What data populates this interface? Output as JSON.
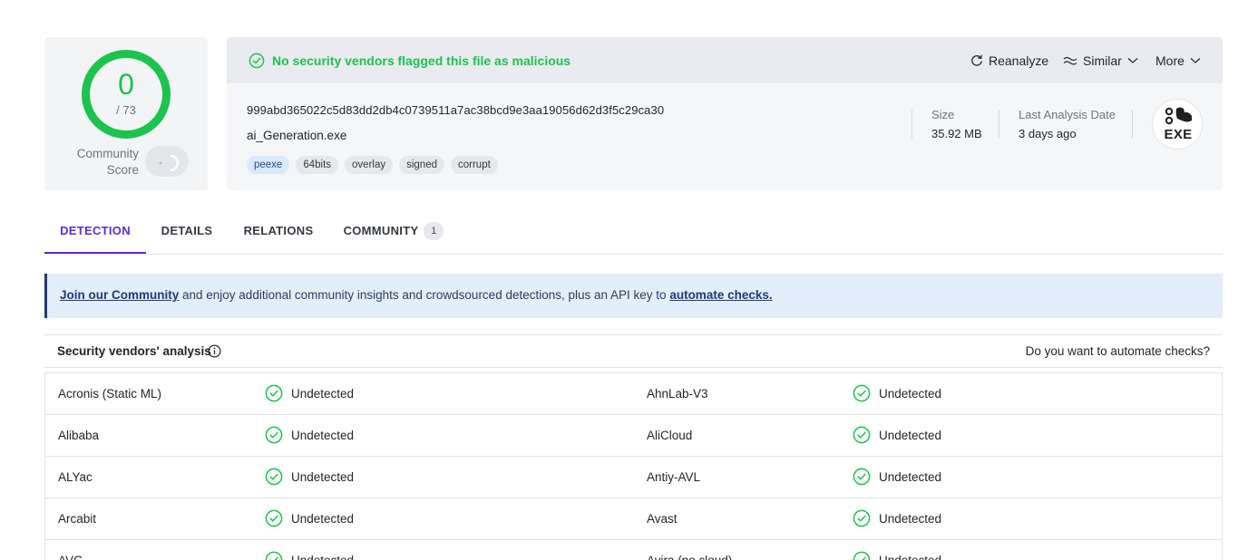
{
  "score": {
    "detections": "0",
    "total": "/ 73",
    "community_label_line1": "Community",
    "community_label_line2": "Score",
    "ring_color": "#1bc44c"
  },
  "status": {
    "message": "No security vendors flagged this file as malicious",
    "icon": "check-circle-icon",
    "color": "#1bc44c"
  },
  "actions": {
    "reanalyze": "Reanalyze",
    "similar": "Similar",
    "more": "More"
  },
  "file": {
    "hash": "999abd365022c5d83dd2db4c0739511a7ac38bcd9e3aa19056d62d3f5c29ca30",
    "name": "ai_Generation.exe",
    "tags": [
      "peexe",
      "64bits",
      "overlay",
      "signed",
      "corrupt"
    ],
    "size_label": "Size",
    "size_value": "35.92 MB",
    "date_label": "Last Analysis Date",
    "date_value": "3 days ago",
    "type_label": "EXE"
  },
  "tabs": {
    "detection": "DETECTION",
    "details": "DETAILS",
    "relations": "RELATIONS",
    "community": "COMMUNITY",
    "community_count": "1"
  },
  "banner": {
    "link1": "Join our Community",
    "text": " and enjoy additional community insights and crowdsourced detections, plus an API key to ",
    "link2": "automate checks."
  },
  "vendors": {
    "title": "Security vendors' analysis",
    "automate_prompt": "Do you want to automate checks?",
    "rows": [
      {
        "left": "Acronis (Static ML)",
        "left_result": "Undetected",
        "right": "AhnLab-V3",
        "right_result": "Undetected"
      },
      {
        "left": "Alibaba",
        "left_result": "Undetected",
        "right": "AliCloud",
        "right_result": "Undetected"
      },
      {
        "left": "ALYac",
        "left_result": "Undetected",
        "right": "Antiy-AVL",
        "right_result": "Undetected"
      },
      {
        "left": "Arcabit",
        "left_result": "Undetected",
        "right": "Avast",
        "right_result": "Undetected"
      },
      {
        "left": "AVG",
        "left_result": "Undetected",
        "right": "Avira (no cloud)",
        "right_result": "Undetected"
      }
    ]
  }
}
